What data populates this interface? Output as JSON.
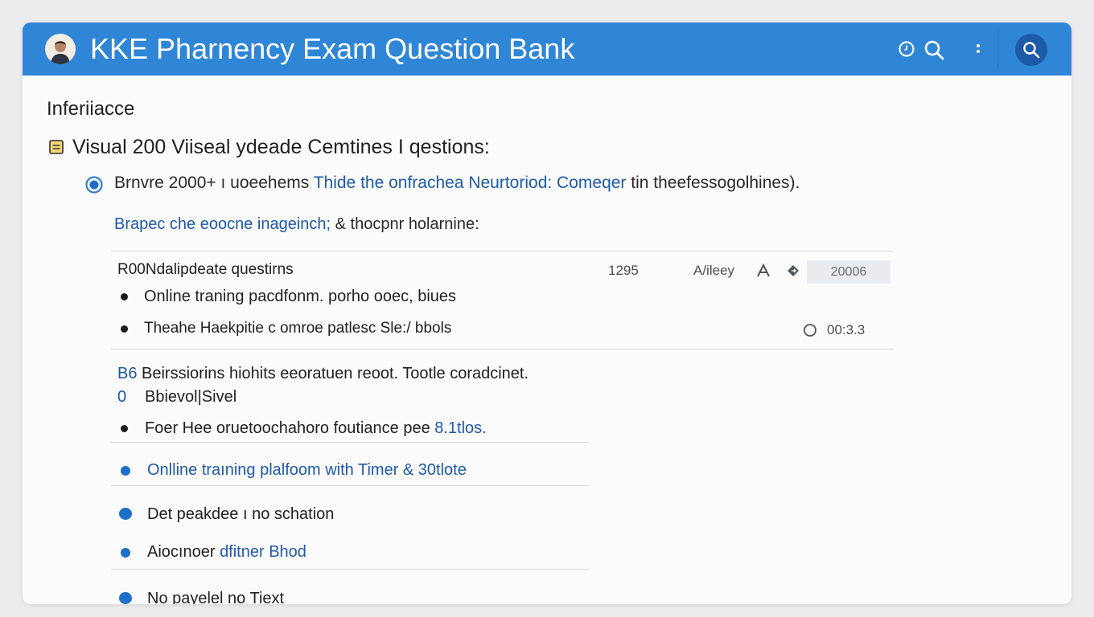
{
  "header": {
    "title": "KKE Pharnency Exam Question Bank",
    "accent_color": "#2f86d6",
    "icons": [
      "avatar",
      "clock-icon",
      "search-icon",
      "kebab-menu-icon",
      "search-button-icon"
    ]
  },
  "main": {
    "section_title": "Inferiiacce",
    "subheading": "Visual 200 Viiseal ydeade Cemtines I qestions:",
    "info": {
      "text": "Brnvre 2000+ ı uoeehems ",
      "link": "Thide the onfrachea Neurtoriod: Comeqer",
      "tail": " tin theefessogolhines)."
    },
    "browse": {
      "link": "Brapec che eoocne inageinch;",
      "rest": " & thocpnr holarnine:"
    },
    "question_row": {
      "title": "R00Ndalipdeate questirns",
      "count": "1295",
      "author": "A/ileey",
      "status": "20006",
      "time": "00:3.3",
      "bullets": [
        "Online traning pacdfonm. porho ooec, biues",
        "Theahe Haekpitie c omroe patlesc Sle:/ bbols"
      ]
    },
    "lower": {
      "line1_prefix": "B6",
      "line1_text": " Beirssiorins hiohits eeoratuen reoot. Tootle coradcinet.",
      "line2_prefix": "0",
      "line2_text": "Bbievol|Sivel",
      "line3_text": "Foer Hee oruetoochahoro foutiance pee ",
      "line3_link": "8.1tlos."
    },
    "list": [
      {
        "text": "Onlline traıning plalfoom with Timer & 30tlote"
      },
      {
        "text": "Det peakdee ı no schation"
      },
      {
        "text": "Aiocınoer ",
        "link": "dfitner Bhod"
      },
      {
        "text": "No payelel no Tiext"
      }
    ]
  }
}
